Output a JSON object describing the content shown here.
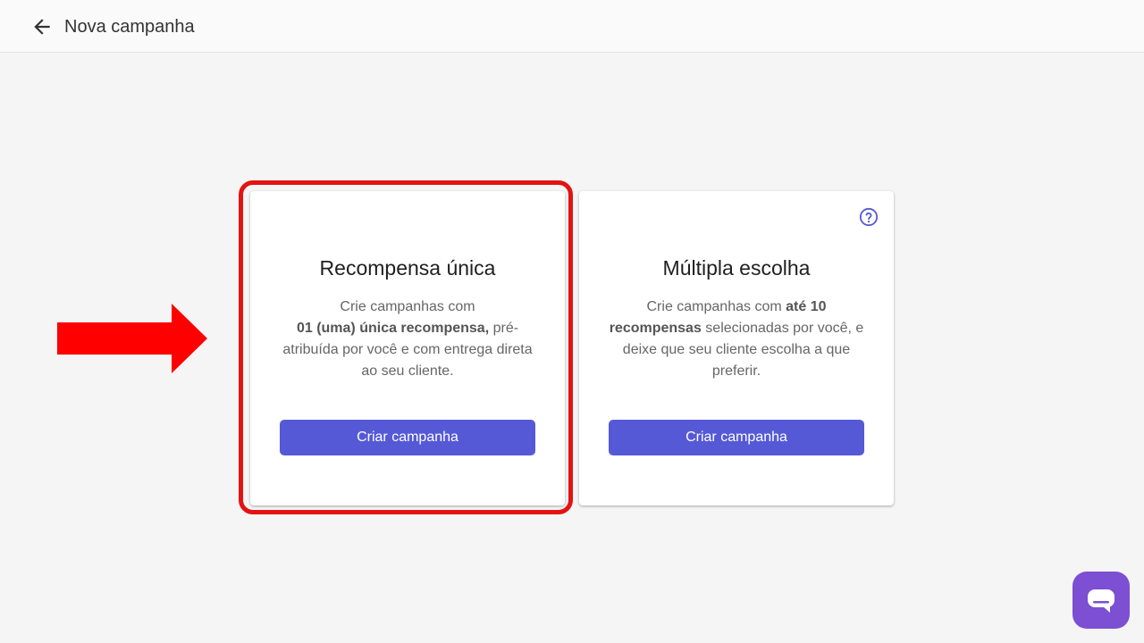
{
  "header": {
    "title": "Nova campanha",
    "back_icon": "arrow-left-icon"
  },
  "cards": [
    {
      "title": "Recompensa única",
      "description": [
        {
          "text": "Crie campanhas com ",
          "bold": false
        },
        {
          "text": "01 (uma) única recompensa,",
          "bold": true
        },
        {
          "text": " pré-atribuída por você e com entrega direta ao seu cliente.",
          "bold": false
        }
      ],
      "button_label": "Criar campanha"
    },
    {
      "title": "Múltipla escolha",
      "description": [
        {
          "text": "Crie campanhas com ",
          "bold": false
        },
        {
          "text": "até 10 recompensas",
          "bold": true
        },
        {
          "text": " selecionadas por você, e deixe que seu cliente escolha a que preferir.",
          "bold": false
        }
      ],
      "button_label": "Criar campanha",
      "help_icon": "question-circle-icon"
    }
  ],
  "annotations": {
    "highlight_color": "#e41313",
    "arrow_color": "#ff0000"
  },
  "chat_widget": {
    "icon": "chat-bubble-icon",
    "color": "#7c4fd3"
  },
  "colors": {
    "accent": "#5659d6",
    "background": "#f5f5f5"
  }
}
